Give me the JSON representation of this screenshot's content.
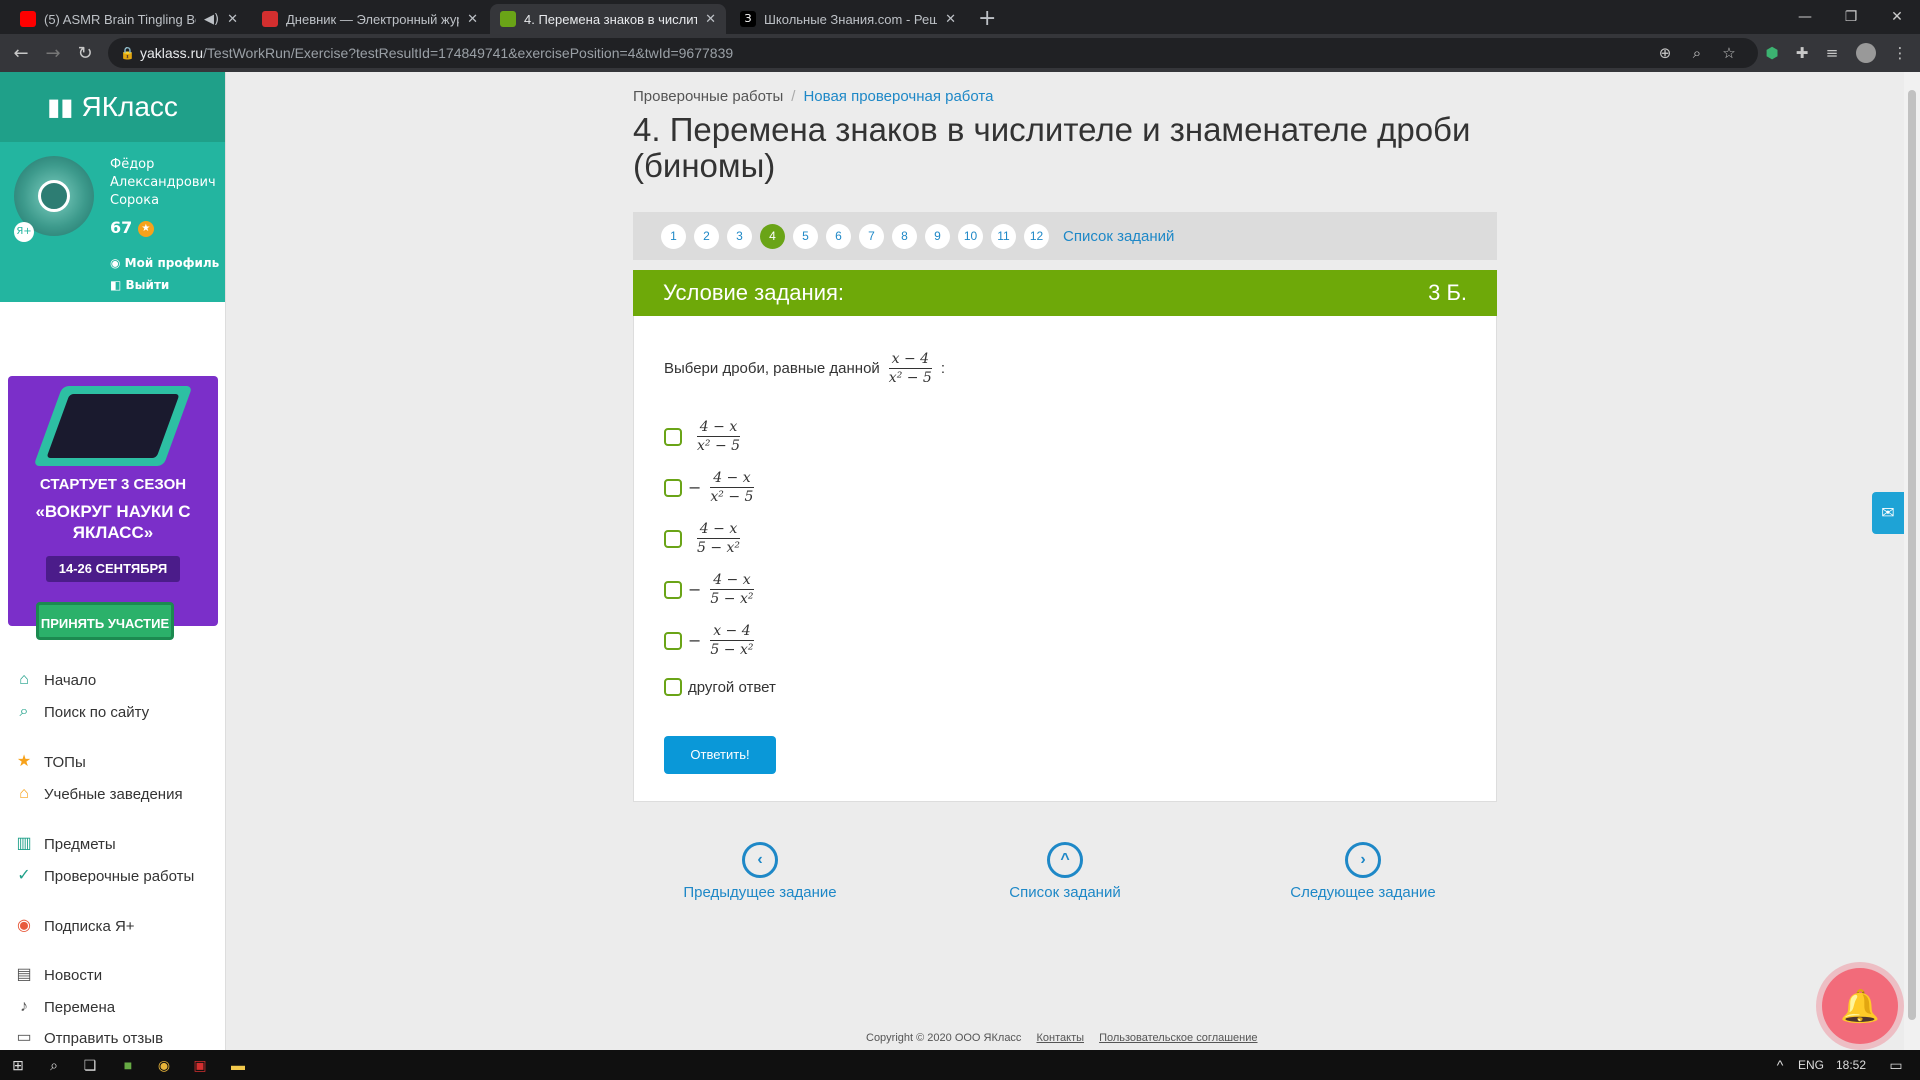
{
  "browser": {
    "tabs": [
      {
        "title": "(5) ASMR Brain Tingling Best",
        "favicon_color": "#ff0000"
      },
      {
        "title": "Дневник — Электронный журн",
        "favicon_color": "#d32f2f"
      },
      {
        "title": "4. Перемена знаков в числител",
        "favicon_color": "#6aa417"
      },
      {
        "title": "Школьные Знания.com - Решае",
        "favicon_color": "#000000"
      }
    ],
    "url_domain": "yaklass.ru",
    "url_path": "/TestWorkRun/Exercise?testResultId=174849741&exercisePosition=4&twId=9677839"
  },
  "sidebar": {
    "logo": "ЯКласс",
    "user_name": "Фёдор Александрович Сорока",
    "points": "67",
    "profile_link": "Мой профиль",
    "logout_link": "Выйти",
    "promo": {
      "line1": "СТАРТУЕТ 3 СЕЗОН",
      "line2": "«ВОКРУГ НАУКИ С ЯКЛАСС»",
      "dates": "14-26 СЕНТЯБРЯ",
      "button": "ПРИНЯТЬ УЧАСТИЕ"
    },
    "menu": [
      {
        "label": "Начало",
        "icon": "home-icon"
      },
      {
        "label": "Поиск по сайту",
        "icon": "search-icon"
      },
      {
        "label": "ТОПы",
        "icon": "star-icon"
      },
      {
        "label": "Учебные заведения",
        "icon": "school-icon"
      },
      {
        "label": "Предметы",
        "icon": "book-icon"
      },
      {
        "label": "Проверочные работы",
        "icon": "check-icon"
      },
      {
        "label": "Подписка Я+",
        "icon": "plus-icon"
      },
      {
        "label": "Новости",
        "icon": "news-icon"
      },
      {
        "label": "Перемена",
        "icon": "bell-icon"
      },
      {
        "label": "Отправить отзыв",
        "icon": "feedback-icon"
      }
    ]
  },
  "main": {
    "breadcrumb": [
      "Проверочные работы",
      "Новая проверочная работа"
    ],
    "title": "4. Перемена знаков в числителе и знаменателе дроби (биномы)",
    "pages": [
      "1",
      "2",
      "3",
      "4",
      "5",
      "6",
      "7",
      "8",
      "9",
      "10",
      "11",
      "12"
    ],
    "current_page": "4",
    "task_list_link": "Список заданий",
    "condition_label": "Условие задания:",
    "points": "3 Б.",
    "question_text": "Выбери дроби, равные данной",
    "question_fraction": {
      "num": "x − 4",
      "den": "x² − 5"
    },
    "question_tail": ":",
    "options": [
      {
        "sign": "",
        "num": "4 − x",
        "den": "x² − 5"
      },
      {
        "sign": "−",
        "num": "4 − x",
        "den": "x² − 5"
      },
      {
        "sign": "",
        "num": "4 − x",
        "den": "5 − x²"
      },
      {
        "sign": "−",
        "num": "4 − x",
        "den": "5 − x²"
      },
      {
        "sign": "−",
        "num": "x − 4",
        "den": "5 − x²"
      }
    ],
    "other_answer": "другой ответ",
    "answer_button": "Ответить!",
    "nav": {
      "prev": "Предыдущее задание",
      "list": "Список заданий",
      "next": "Следующее задание"
    }
  },
  "footer": {
    "copyright": "Copyright © 2020 ООО ЯКласс",
    "contacts": "Контакты",
    "agreement": "Пользовательское соглашение"
  },
  "taskbar": {
    "lang": "ENG",
    "time": "18:52"
  }
}
